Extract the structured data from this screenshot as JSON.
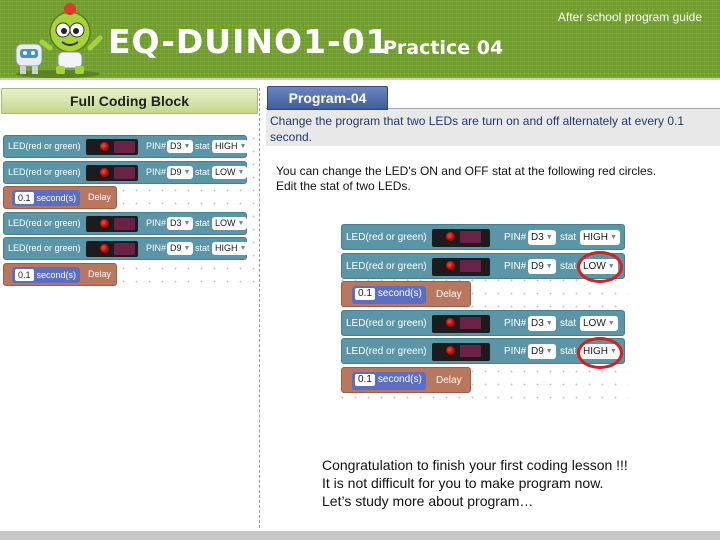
{
  "header": {
    "title": "EQ-DUINO1-01",
    "subtitle": "Practice 04",
    "note": "After school program guide",
    "colors": {
      "band": "#6f9d2a",
      "text": "#ffffff"
    },
    "mascot_icon": "robot-mascot-icon"
  },
  "left_panel": {
    "tab_label": "Full Coding Block"
  },
  "right_panel": {
    "tab_label": "Program-04",
    "description_line1": "Change the program that two LEDs are turn on and off alternately at every 0.1",
    "description_line2": "second.",
    "hint_line1": "You can change the LED's ON and OFF stat at the following red circles.",
    "hint_line2": "Edit the stat of two LEDs.",
    "congrats_line1": "Congratulation to finish your first coding lesson !!!",
    "congrats_line2": "It is not difficult for you to make program now.",
    "congrats_line3": "Let’s study more about program…"
  },
  "blocks_left": [
    {
      "kind": "led",
      "label": "LED(red or green)",
      "pin_label": "PIN#",
      "pin": "D3",
      "stat_label": "stat",
      "stat": "HIGH"
    },
    {
      "kind": "led",
      "label": "LED(red or green)",
      "pin_label": "PIN#",
      "pin": "D9",
      "stat_label": "stat",
      "stat": "LOW"
    },
    {
      "kind": "delay",
      "value": "0.1",
      "unit": "second(s)",
      "label": "Delay"
    },
    {
      "kind": "led",
      "label": "LED(red or green)",
      "pin_label": "PIN#",
      "pin": "D3",
      "stat_label": "stat",
      "stat": "LOW"
    },
    {
      "kind": "led",
      "label": "LED(red or green)",
      "pin_label": "PIN#",
      "pin": "D9",
      "stat_label": "stat",
      "stat": "HIGH"
    },
    {
      "kind": "delay",
      "value": "0.1",
      "unit": "second(s)",
      "label": "Delay"
    }
  ],
  "blocks_right": [
    {
      "kind": "led",
      "label": "LED(red or green)",
      "pin_label": "PIN#",
      "pin": "D3",
      "stat_label": "stat",
      "stat": "HIGH"
    },
    {
      "kind": "led",
      "label": "LED(red or green)",
      "pin_label": "PIN#",
      "pin": "D9",
      "stat_label": "stat",
      "stat": "LOW"
    },
    {
      "kind": "delay",
      "value": "0.1",
      "unit": "second(s)",
      "label": "Delay"
    },
    {
      "kind": "led",
      "label": "LED(red or green)",
      "pin_label": "PIN#",
      "pin": "D3",
      "stat_label": "stat",
      "stat": "LOW"
    },
    {
      "kind": "led",
      "label": "LED(red or green)",
      "pin_label": "PIN#",
      "pin": "D9",
      "stat_label": "stat",
      "stat": "HIGH"
    },
    {
      "kind": "delay",
      "value": "0.1",
      "unit": "second(s)",
      "label": "Delay"
    }
  ],
  "block_colors": {
    "led": "#5b95a8",
    "delay": "#b9775d",
    "seconds": "#5a6ec2",
    "highlight_circle": "#d42020"
  }
}
